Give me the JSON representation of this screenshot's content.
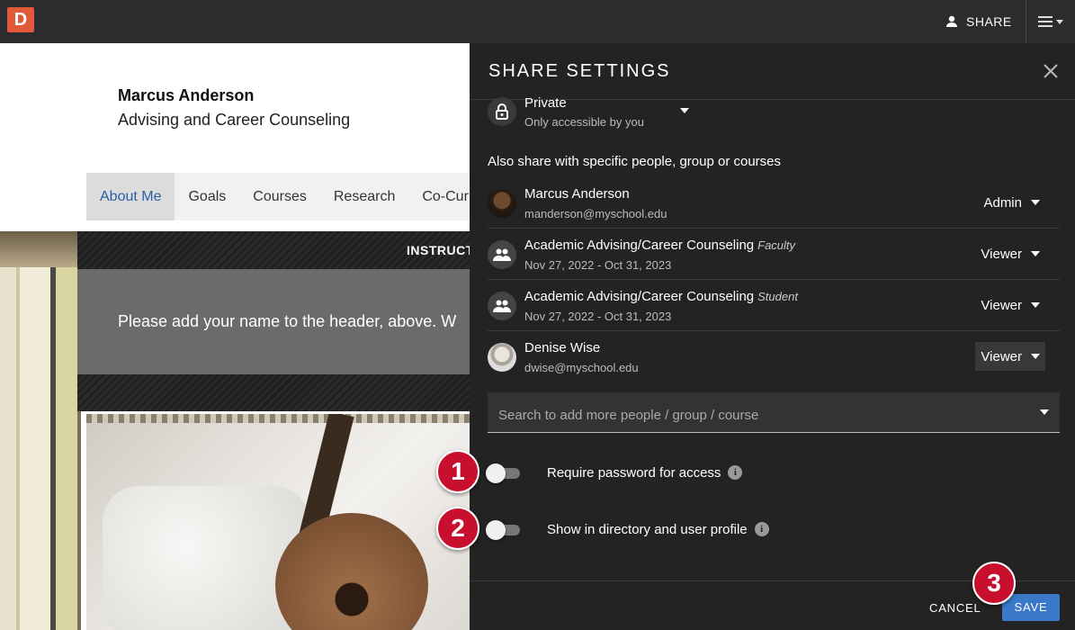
{
  "topbar": {
    "logo_letter": "D",
    "share_label": "SHARE"
  },
  "page": {
    "owner_name": "Marcus Anderson",
    "owner_dept": "Advising and Career Counseling",
    "tabs": [
      {
        "label": "About Me",
        "active": true
      },
      {
        "label": "Goals"
      },
      {
        "label": "Courses"
      },
      {
        "label": "Research"
      },
      {
        "label": "Co-Cur"
      }
    ],
    "instruct_label": "INSTRUCT",
    "instruct_text": "Please add your name to the header, above. W"
  },
  "panel": {
    "title": "SHARE SETTINGS",
    "privacy": {
      "title": "Private",
      "subtitle": "Only accessible by you"
    },
    "also_share": "Also share with specific people, group or courses",
    "people": [
      {
        "name": "Marcus Anderson",
        "role": "",
        "sub": "manderson@myschool.edu",
        "permission": "Admin",
        "avatar": "photo1"
      },
      {
        "name": "Academic Advising/Career Counseling",
        "role": "Faculty",
        "sub": "Nov 27, 2022 - Oct 31, 2023",
        "permission": "Viewer",
        "avatar": "group"
      },
      {
        "name": "Academic Advising/Career Counseling",
        "role": "Student",
        "sub": "Nov 27, 2022 - Oct 31, 2023",
        "permission": "Viewer",
        "avatar": "group"
      },
      {
        "name": "Denise Wise",
        "role": "",
        "sub": "dwise@myschool.edu",
        "permission": "Viewer",
        "avatar": "photo2"
      }
    ],
    "search_placeholder": "Search to add more people / group / course",
    "toggles": {
      "password_label": "Require password for access",
      "password_on": false,
      "directory_label": "Show in directory and user profile",
      "directory_on": false
    },
    "cancel_label": "CANCEL",
    "save_label": "SAVE"
  },
  "badges": [
    "1",
    "2",
    "3"
  ],
  "colors": {
    "accent_blue": "#3a78c9",
    "badge_red": "#c8102e",
    "logo_orange": "#e05a3a",
    "panel_bg": "#232323"
  }
}
